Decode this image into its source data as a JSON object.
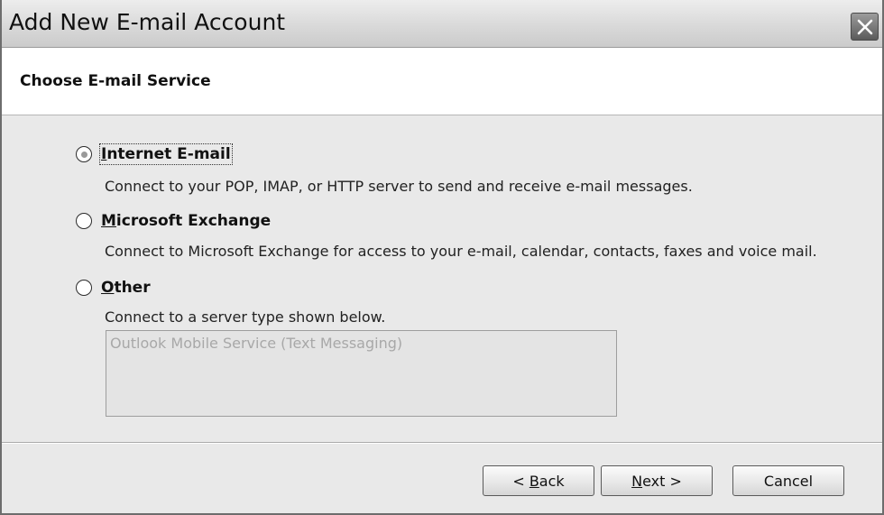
{
  "window": {
    "title": "Add New E-mail Account",
    "close_icon": "close-icon"
  },
  "header": {
    "title": "Choose E-mail Service"
  },
  "options": [
    {
      "accel": "I",
      "label_rest": "nternet E-mail",
      "description": "Connect to your POP, IMAP, or HTTP server to send and receive e-mail messages.",
      "selected": true
    },
    {
      "accel": "M",
      "label_rest": "icrosoft Exchange",
      "description": "Connect to Microsoft Exchange for access to your e-mail, calendar, contacts, faxes and voice mail.",
      "selected": false
    },
    {
      "accel": "O",
      "label_rest": "ther",
      "description": "Connect to a server type shown below.",
      "selected": false
    }
  ],
  "server_list": {
    "items": [
      "Outlook Mobile Service (Text Messaging)"
    ]
  },
  "buttons": {
    "back_prefix": "< ",
    "back_accel": "B",
    "back_rest": "ack",
    "next_accel": "N",
    "next_rest": "ext >",
    "cancel": "Cancel"
  },
  "colors": {
    "dialog_bg": "#e9e9e9",
    "header_bg": "#ffffff",
    "titlebar": "#d9d9d9"
  }
}
